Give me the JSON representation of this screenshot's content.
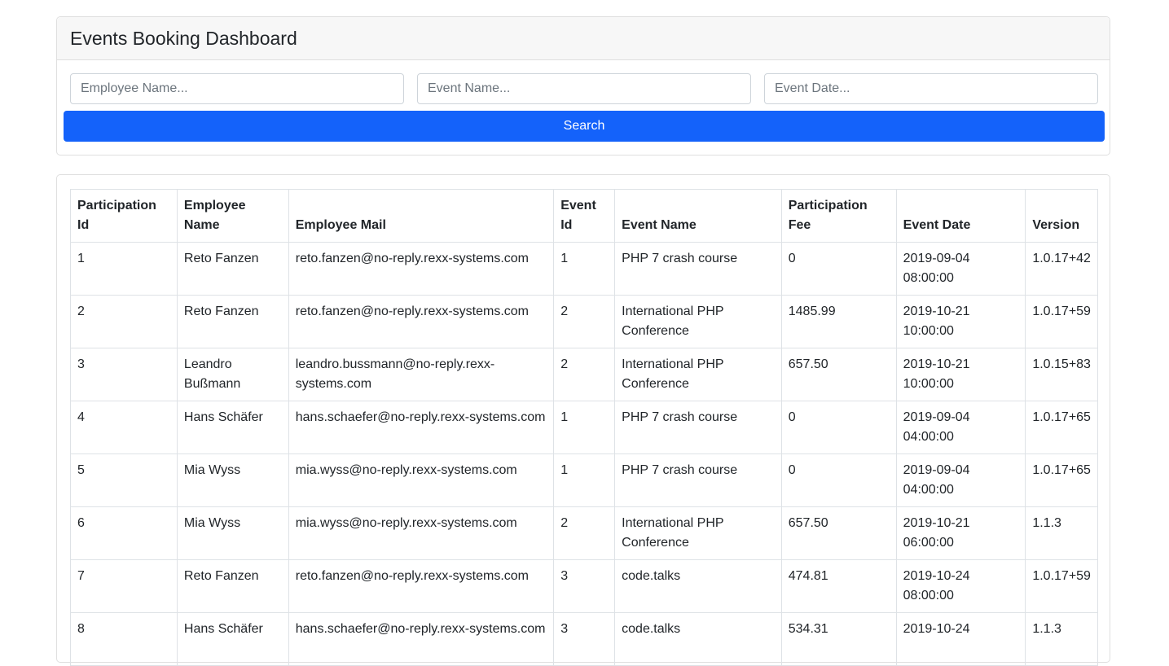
{
  "header": {
    "title": "Events Booking Dashboard"
  },
  "filters": {
    "employee_placeholder": "Employee Name...",
    "event_placeholder": "Event Name...",
    "date_placeholder": "Event Date...",
    "search_label": "Search"
  },
  "table": {
    "columns": [
      "Participation Id",
      "Employee Name",
      "Employee Mail",
      "Event Id",
      "Event Name",
      "Participation Fee",
      "Event Date",
      "Version"
    ],
    "rows": [
      [
        "1",
        "Reto Fanzen",
        "reto.fanzen@no-reply.rexx-systems.com",
        "1",
        "PHP 7 crash course",
        "0",
        "2019-09-04 08:00:00",
        "1.0.17+42"
      ],
      [
        "2",
        "Reto Fanzen",
        "reto.fanzen@no-reply.rexx-systems.com",
        "2",
        "International PHP Conference",
        "1485.99",
        "2019-10-21 10:00:00",
        "1.0.17+59"
      ],
      [
        "3",
        "Leandro Bußmann",
        "leandro.bussmann@no-reply.rexx-systems.com",
        "2",
        "International PHP Conference",
        "657.50",
        "2019-10-21 10:00:00",
        "1.0.15+83"
      ],
      [
        "4",
        "Hans Schäfer",
        "hans.schaefer@no-reply.rexx-systems.com",
        "1",
        "PHP 7 crash course",
        "0",
        "2019-09-04 04:00:00",
        "1.0.17+65"
      ],
      [
        "5",
        "Mia Wyss",
        "mia.wyss@no-reply.rexx-systems.com",
        "1",
        "PHP 7 crash course",
        "0",
        "2019-09-04 04:00:00",
        "1.0.17+65"
      ],
      [
        "6",
        "Mia Wyss",
        "mia.wyss@no-reply.rexx-systems.com",
        "2",
        "International PHP Conference",
        "657.50",
        "2019-10-21 06:00:00",
        "1.1.3"
      ],
      [
        "7",
        "Reto Fanzen",
        "reto.fanzen@no-reply.rexx-systems.com",
        "3",
        "code.talks",
        "474.81",
        "2019-10-24 08:00:00",
        "1.0.17+59"
      ],
      [
        "8",
        "Hans Schäfer",
        "hans.schaefer@no-reply.rexx-systems.com",
        "3",
        "code.talks",
        "534.31",
        "2019-10-24",
        "1.1.3"
      ]
    ]
  }
}
